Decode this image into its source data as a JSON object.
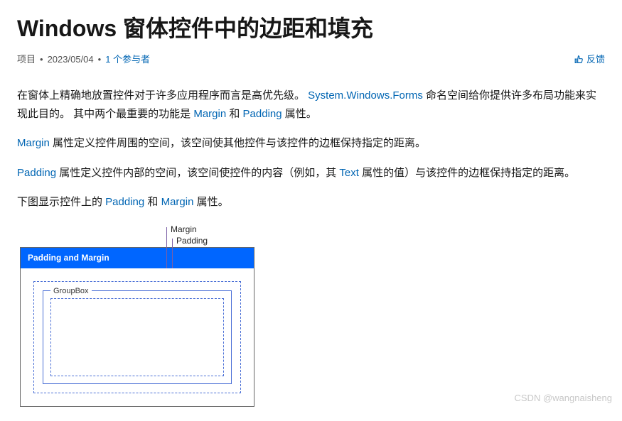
{
  "title": "Windows 窗体控件中的边距和填充",
  "meta": {
    "project": "项目",
    "date": "2023/05/04",
    "contributors": "1 个参与者",
    "feedback": "反馈"
  },
  "paragraphs": {
    "p1a": "在窗体上精确地放置控件对于许多应用程序而言是高优先级。 ",
    "p1_link1": "System.Windows.Forms",
    "p1b": " 命名空间给你提供许多布局功能来实现此目的。 其中两个最重要的功能是 ",
    "p1_link2": "Margin",
    "p1c": " 和 ",
    "p1_link3": "Padding",
    "p1d": " 属性。",
    "p2_link1": "Margin",
    "p2a": " 属性定义控件周围的空间，该空间使其他控件与该控件的边框保持指定的距离。",
    "p3_link1": "Padding",
    "p3a": " 属性定义控件内部的空间，该空间使控件的内容（例如，其 ",
    "p3_link2": "Text",
    "p3b": " 属性的值）与该控件的边框保持指定的距离。",
    "p4a": "下图显示控件上的 ",
    "p4_link1": "Padding",
    "p4b": " 和 ",
    "p4_link2": "Margin",
    "p4c": " 属性。"
  },
  "diagram": {
    "label_margin": "Margin",
    "label_padding": "Padding",
    "panel_title": "Padding and Margin",
    "groupbox_label": "GroupBox"
  },
  "watermark": "CSDN @wangnaisheng"
}
